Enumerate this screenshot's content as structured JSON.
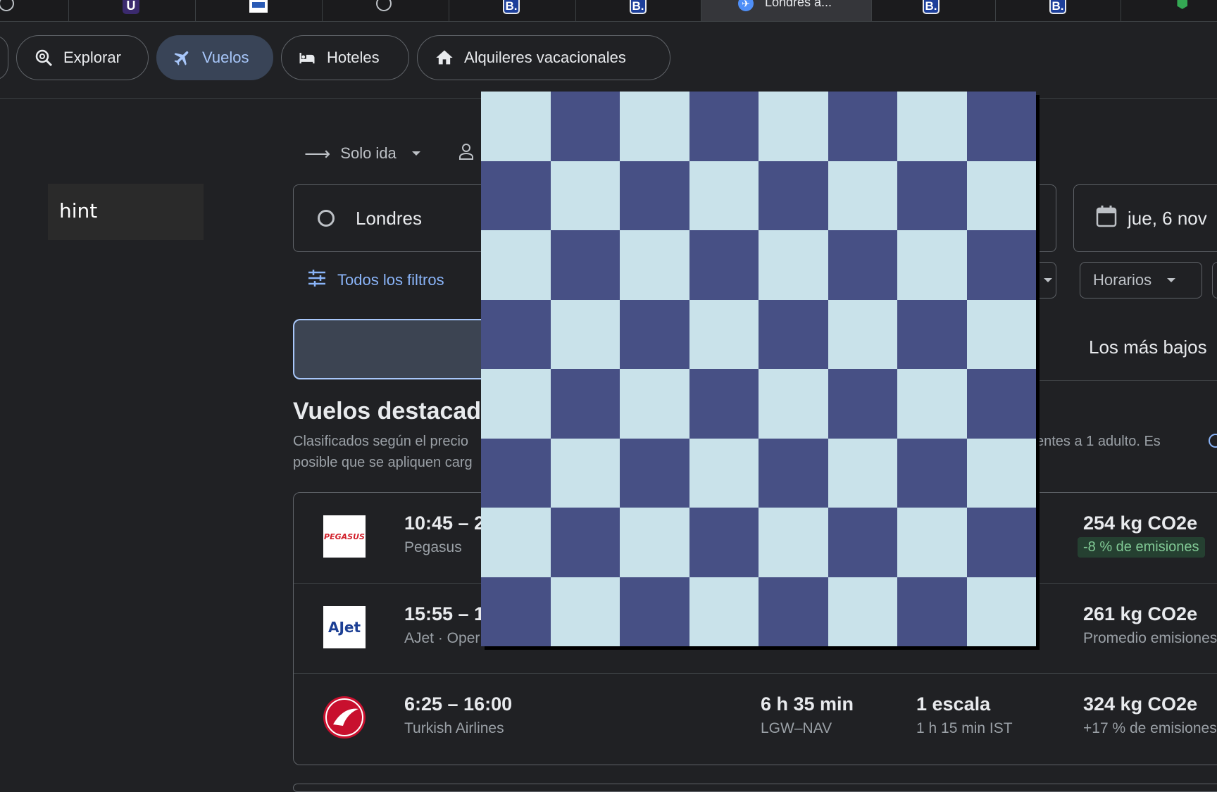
{
  "browser": {
    "tabs": [
      {
        "icon": "chatgpt-icon"
      },
      {
        "icon": "u-app-icon",
        "glyph": "U"
      },
      {
        "icon": "jasna-icon"
      },
      {
        "icon": "chatgpt-icon"
      },
      {
        "icon": "booking-icon",
        "glyph": "B."
      },
      {
        "icon": "booking-icon",
        "glyph": "B."
      },
      {
        "icon": "google-flights-icon",
        "title": "Londres a...",
        "active": true
      },
      {
        "icon": "booking-icon",
        "glyph": "B."
      },
      {
        "icon": "booking-icon",
        "glyph": "B."
      },
      {
        "icon": "google-maps-icon"
      }
    ]
  },
  "nav": {
    "explorar": "Explorar",
    "vuelos": "Vuelos",
    "hoteles": "Hoteles",
    "alquileres": "Alquileres vacacionales"
  },
  "hint": "hint",
  "search": {
    "trip_type": "Solo ida",
    "origin": "Londres",
    "date": "jue, 6 nov",
    "all_filters": "Todos los filtros",
    "horarios": "Horarios",
    "sort_lowest": "Los más bajos"
  },
  "results": {
    "heading": "Vuelos destacado",
    "desc_line1_left": "Clasificados según el precio",
    "desc_line1_right": "entes a 1 adulto. Es",
    "desc_line2_left": "posible que se apliquen carg",
    "flights": [
      {
        "logo": "pegasus-logo",
        "logo_text": "PEGASUS",
        "times": "10:45 – 2",
        "airline": "Pegasus",
        "duration": "",
        "route": "",
        "stops": "",
        "stop_detail": "",
        "emissions": "254 kg CO2e",
        "emissions_note": "-8 % de emisiones",
        "emissions_badge": true
      },
      {
        "logo": "ajet-logo",
        "logo_text": "AJet",
        "times": "15:55 – 1",
        "airline": "AJet · Oper",
        "duration": "",
        "route": "",
        "stops": "",
        "stop_detail": "",
        "emissions": "261 kg CO2e",
        "emissions_note": "Promedio emisiones",
        "emissions_badge": false
      },
      {
        "logo": "turkish-airlines-logo",
        "logo_text": "",
        "times": "6:25 – 16:00",
        "airline": "Turkish Airlines",
        "duration": "6 h 35 min",
        "route": "LGW–NAV",
        "stops": "1 escala",
        "stop_detail": "1 h 15 min IST",
        "emissions": "324 kg CO2e",
        "emissions_note": "+17 % de emisiones",
        "emissions_badge": false
      }
    ]
  },
  "overlay": {
    "type": "checkerboard",
    "rows": 8,
    "cols": 8,
    "color_light": "#c9e2ea",
    "color_dark": "#475085"
  },
  "colors": {
    "background": "#202124",
    "accent": "#8ab4f8",
    "active_chip": "#394457",
    "eco_green": "#81c995"
  }
}
